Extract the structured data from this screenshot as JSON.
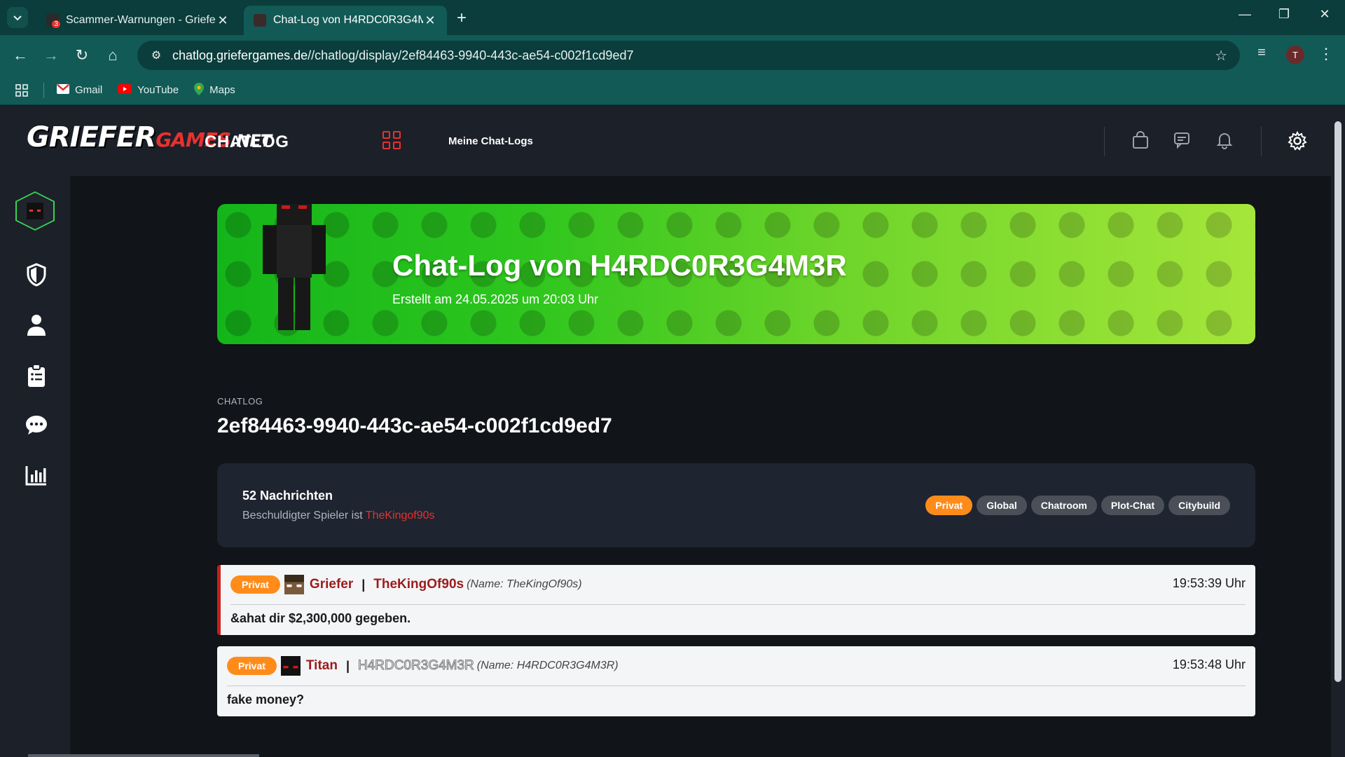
{
  "browser": {
    "tabs": [
      {
        "title": "Scammer-Warnungen - GrieferGames",
        "badge": "3"
      },
      {
        "title": "Chat-Log von H4RDC0R3G4M3R"
      }
    ],
    "url_host": "chatlog.griefergames.de",
    "url_path": "//chatlog/display/2ef84463-9940-443c-ae54-c002f1cd9ed7",
    "profile_initial": "T",
    "bookmarks": [
      {
        "label": "Gmail",
        "icon": "gmail-icon"
      },
      {
        "label": "YouTube",
        "icon": "youtube-icon"
      },
      {
        "label": "Maps",
        "icon": "maps-icon"
      }
    ]
  },
  "header": {
    "logo_main": "GRIEFER",
    "logo_sub": "GAMES",
    "logo_tld": ".NET",
    "title": "CHATLOG",
    "nav_link": "Meine Chat-Logs"
  },
  "banner": {
    "title": "Chat-Log von H4RDC0R3G4M3R",
    "subtitle": "Erstellt am 24.05.2025 um 20:03 Uhr"
  },
  "log": {
    "label": "CHATLOG",
    "id": "2ef84463-9940-443c-ae54-c002f1cd9ed7",
    "count": "52 Nachrichten",
    "accused_prefix": "Beschuldigter Spieler ist",
    "accused_player": "TheKingof90s",
    "filters": [
      {
        "label": "Privat",
        "active": true
      },
      {
        "label": "Global",
        "active": false
      },
      {
        "label": "Chatroom",
        "active": false
      },
      {
        "label": "Plot-Chat",
        "active": false
      },
      {
        "label": "Citybuild",
        "active": false
      }
    ]
  },
  "messages": [
    {
      "tag": "Privat",
      "rank": "Griefer",
      "player": "TheKingOf90s",
      "meta": "(Name: TheKingOf90s)",
      "time": "19:53:39 Uhr",
      "text": "&ahat dir $2,300,000 gegeben."
    },
    {
      "tag": "Privat",
      "rank": "Titan",
      "player": "H4RDC0R3G4M3R",
      "meta": "(Name: H4RDC0R3G4M3R)",
      "time": "19:53:48 Uhr",
      "text": "fake money?"
    }
  ],
  "colors": {
    "accent_red": "#e8312f",
    "chip_active": "#ff8c1a",
    "banner_green": "#2ec61e"
  }
}
